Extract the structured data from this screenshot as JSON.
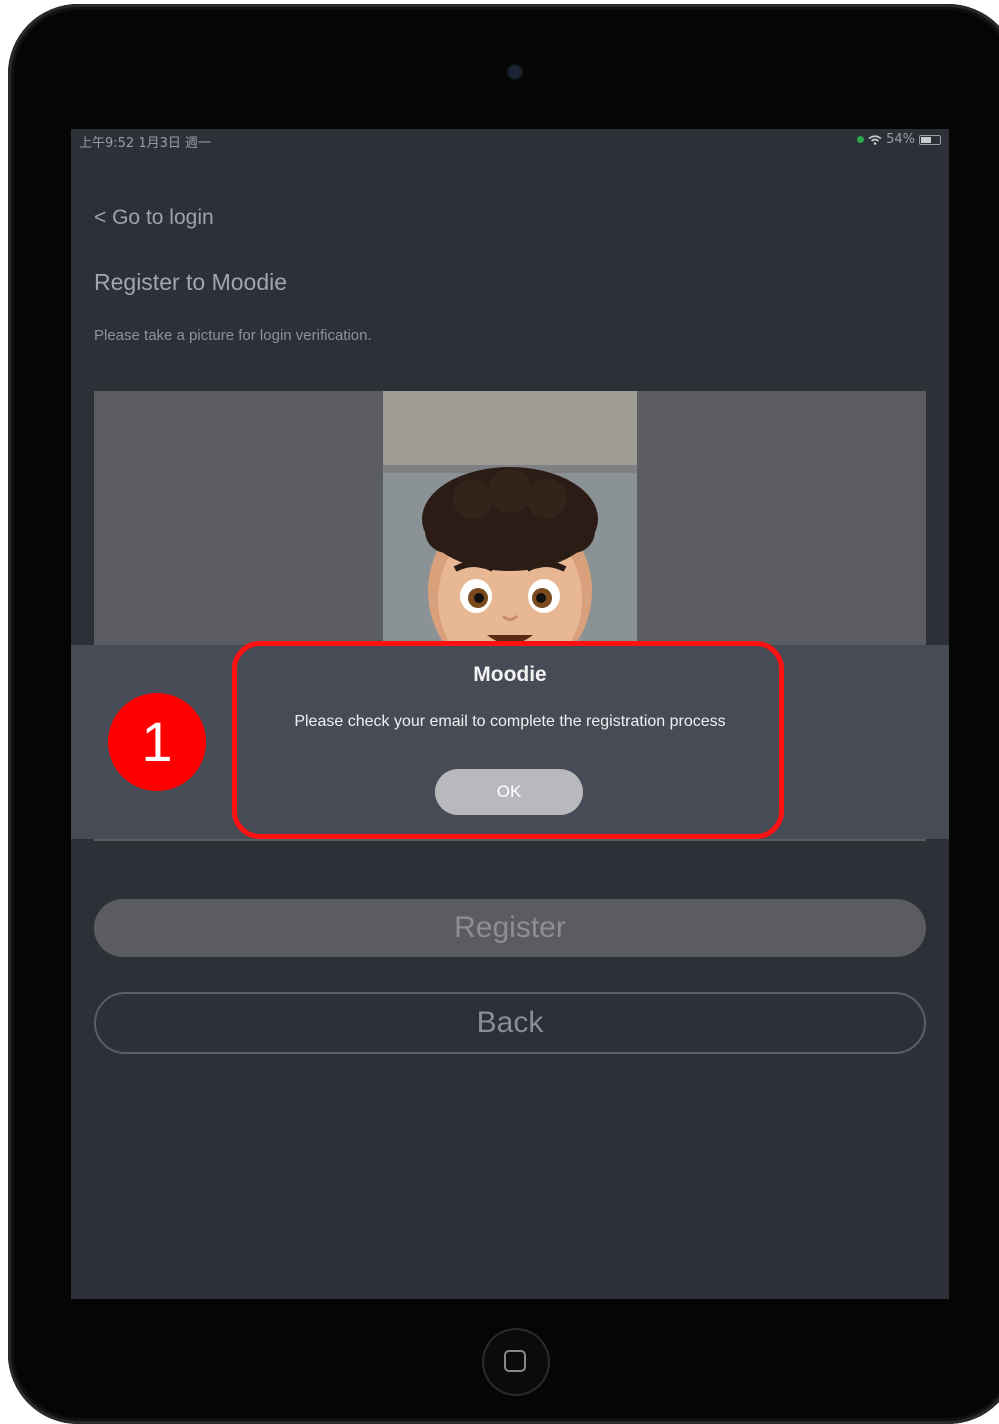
{
  "status_bar": {
    "time_date": "上午9:52  1月3日 週一",
    "battery": "54%",
    "battery_level": 0.54
  },
  "nav": {
    "back_link": "< Go to login"
  },
  "header": {
    "title": "Register to Moodie",
    "subtitle": "Please take a picture for login verification."
  },
  "photo": {
    "icon": "memoji-face-icon"
  },
  "dialog": {
    "title": "Moodie",
    "message": "Please check your email to complete the registration process",
    "ok_label": "OK"
  },
  "buttons": {
    "register_label": "Register",
    "back_label": "Back"
  },
  "annotation": {
    "step_number": "1",
    "highlight_color": "#ff1111",
    "badge_color": "#ff0000"
  },
  "colors": {
    "screen_bg": "#2e3038",
    "dialog_bg": "#474b55"
  }
}
